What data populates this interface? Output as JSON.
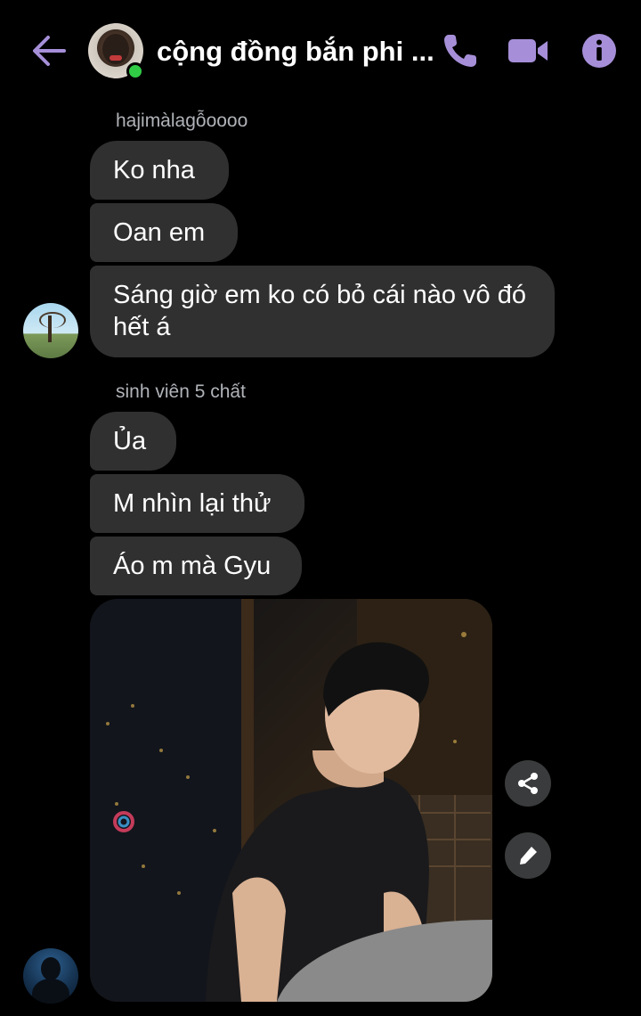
{
  "header": {
    "title": "cộng đồng bắn phi ...",
    "online": true,
    "accent_color": "#a68fd8"
  },
  "messages": [
    {
      "sender": "hajimàlagỗoooo",
      "bubbles": [
        "Ko nha",
        "Oan em",
        "Sáng giờ em ko có bỏ cái nào vô đó hết á"
      ]
    },
    {
      "sender": "sinh viên 5 chất",
      "bubbles": [
        "Ủa",
        "M nhìn lại thử",
        "Áo m mà Gyu"
      ]
    }
  ],
  "image_actions": [
    "share-icon",
    "edit-icon"
  ],
  "colors": {
    "background": "#000000",
    "bubble": "#303030",
    "sender_label": "#b0b3b8",
    "online": "#31cc46"
  }
}
